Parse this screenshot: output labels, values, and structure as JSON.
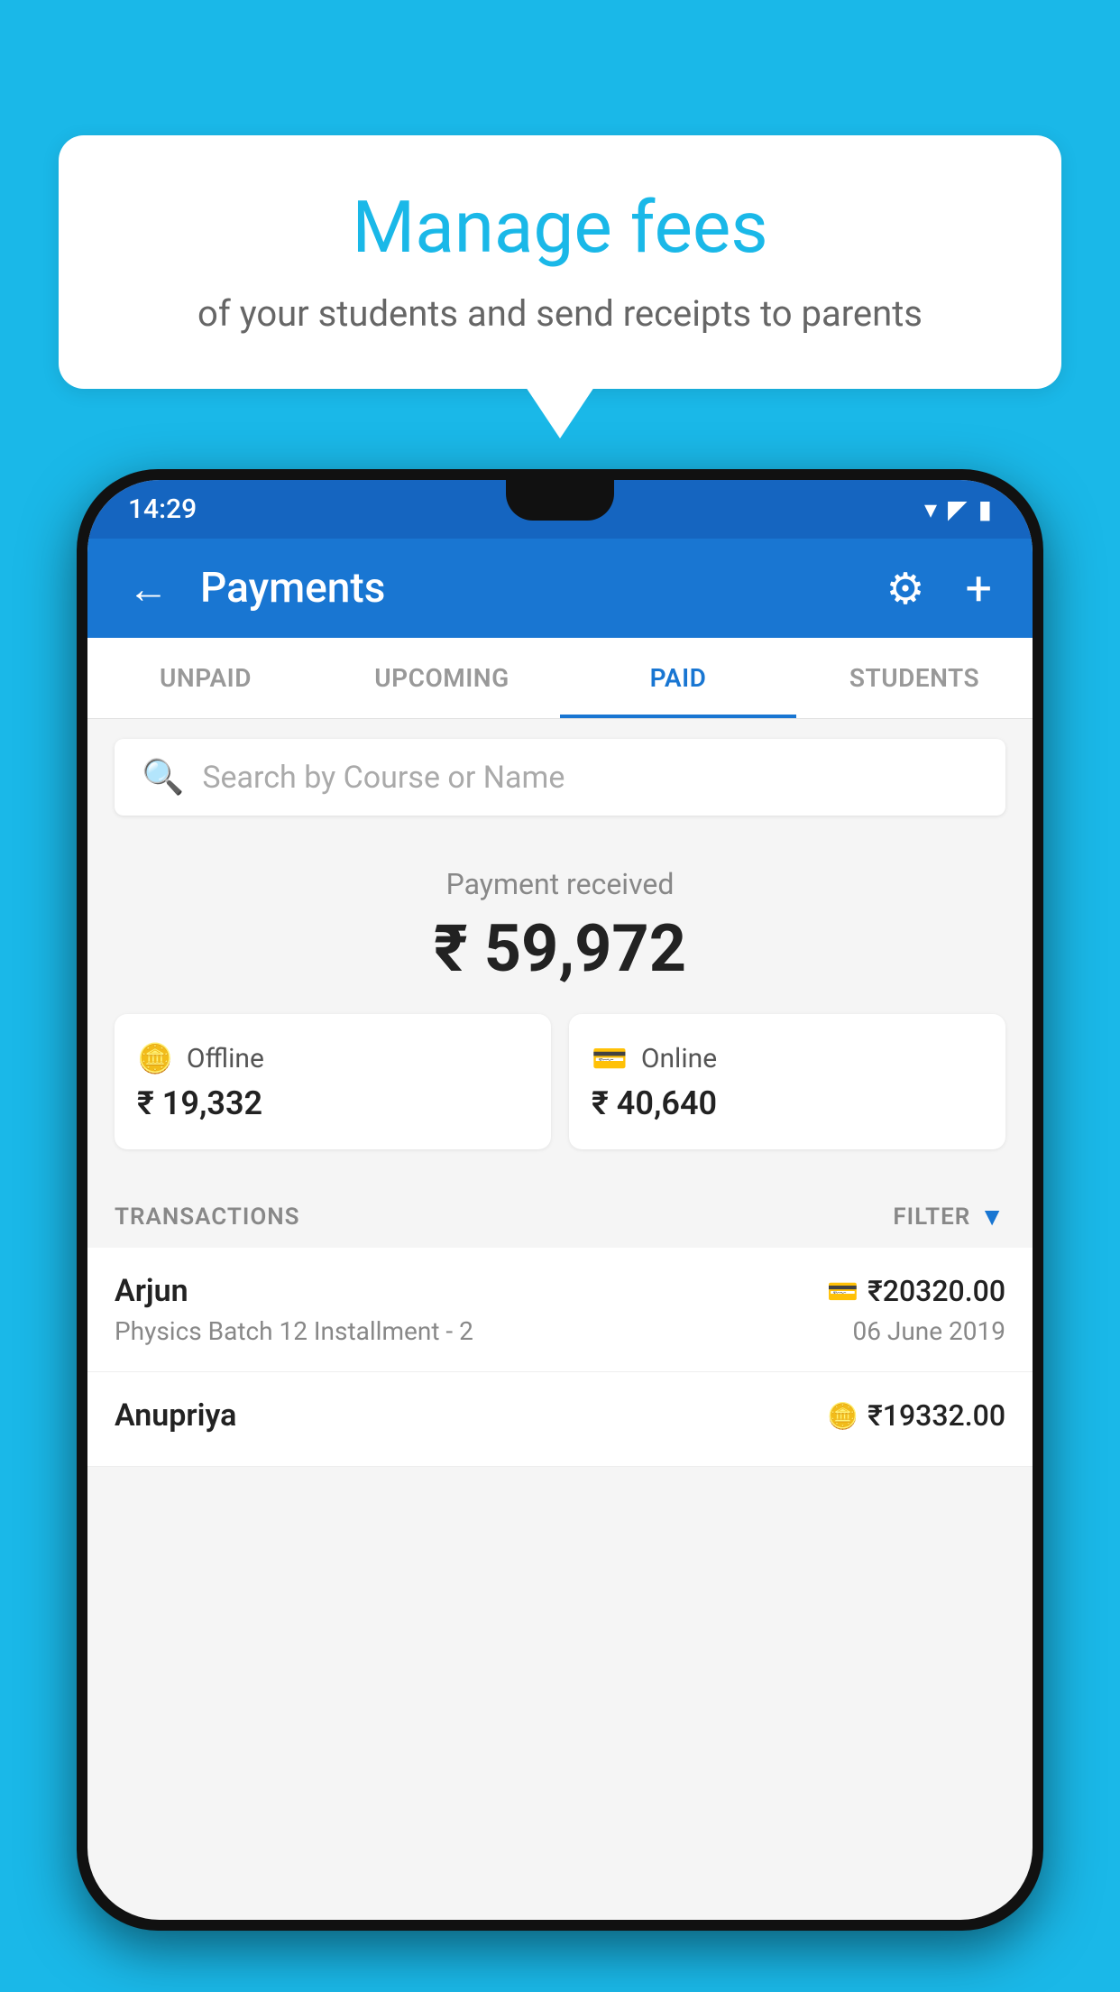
{
  "background_color": "#1ab8e8",
  "speech_bubble": {
    "title": "Manage fees",
    "subtitle": "of your students and send receipts to parents"
  },
  "status_bar": {
    "time": "14:29",
    "wifi": "▾",
    "signal": "▲",
    "battery": "▪"
  },
  "app_bar": {
    "title": "Payments",
    "back_icon": "←",
    "gear_icon": "⚙",
    "plus_icon": "+"
  },
  "tabs": [
    {
      "label": "UNPAID",
      "active": false
    },
    {
      "label": "UPCOMING",
      "active": false
    },
    {
      "label": "PAID",
      "active": true
    },
    {
      "label": "STUDENTS",
      "active": false
    }
  ],
  "search": {
    "placeholder": "Search by Course or Name"
  },
  "payment_summary": {
    "label": "Payment received",
    "amount": "₹ 59,972",
    "offline_label": "Offline",
    "offline_amount": "₹ 19,332",
    "online_label": "Online",
    "online_amount": "₹ 40,640"
  },
  "transactions": {
    "label": "TRANSACTIONS",
    "filter_label": "FILTER",
    "items": [
      {
        "name": "Arjun",
        "amount": "₹20320.00",
        "course": "Physics Batch 12 Installment - 2",
        "date": "06 June 2019",
        "icon_type": "card"
      },
      {
        "name": "Anupriya",
        "amount": "₹19332.00",
        "course": "",
        "date": "",
        "icon_type": "cash"
      }
    ]
  }
}
